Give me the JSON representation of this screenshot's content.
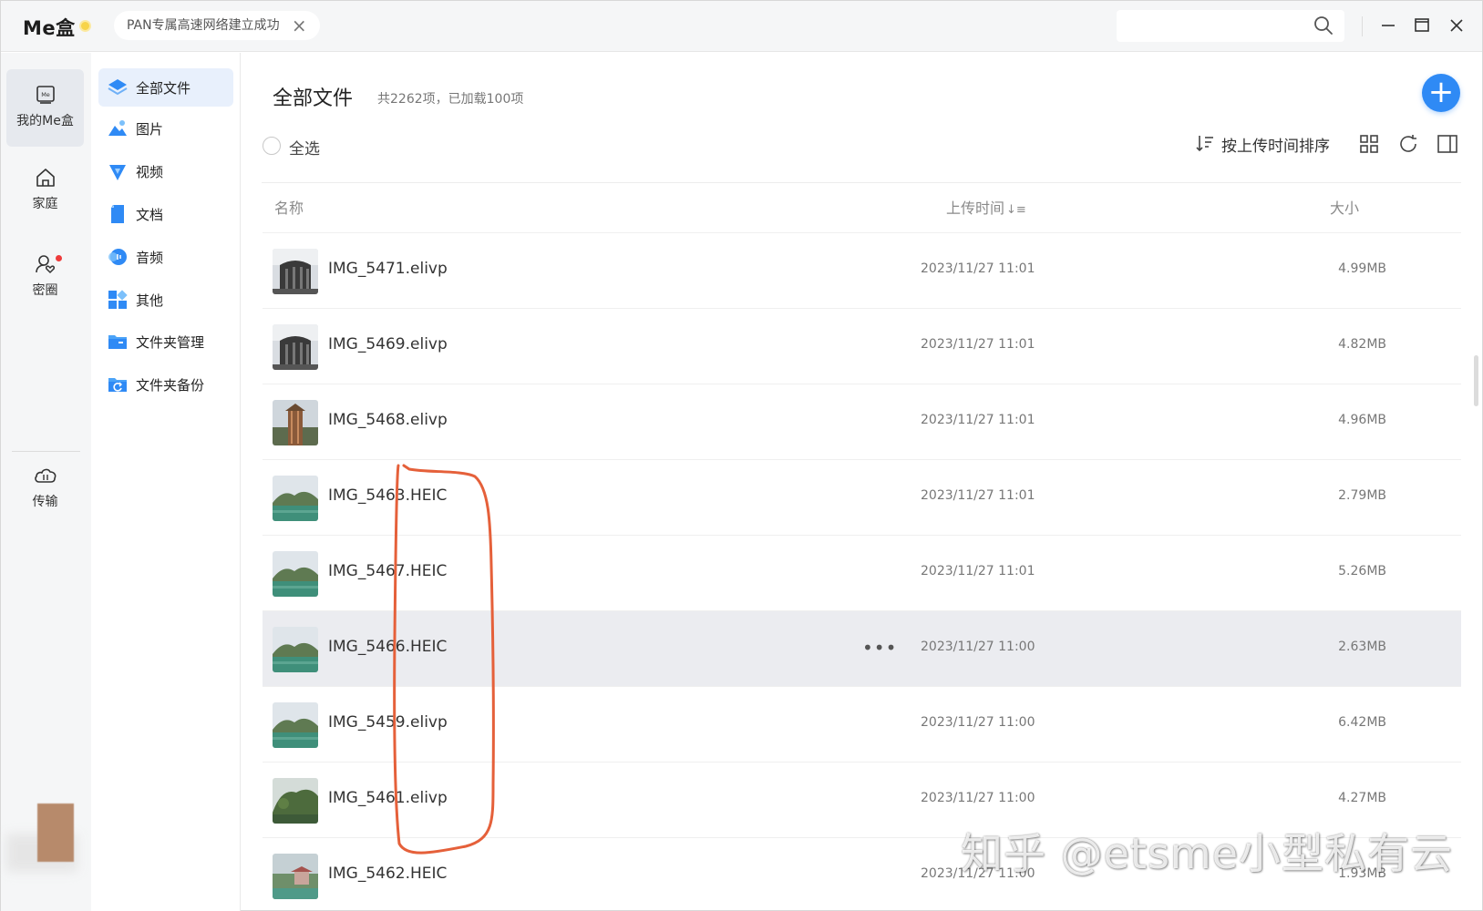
{
  "app": {
    "title": "Me盒",
    "notice": "PAN专属高速网络建立成功"
  },
  "rail": {
    "items": [
      {
        "label": "我的Me盒",
        "icon": "me-box-icon",
        "active": true
      },
      {
        "label": "家庭",
        "icon": "home-icon",
        "active": false
      },
      {
        "label": "密圈",
        "icon": "circle-friends-icon",
        "active": false,
        "badge": true
      },
      {
        "label": "传输",
        "icon": "cloud-transfer-icon",
        "active": false
      }
    ]
  },
  "categories": [
    {
      "label": "全部文件",
      "icon": "all-files-icon",
      "active": true
    },
    {
      "label": "图片",
      "icon": "pictures-icon",
      "active": false
    },
    {
      "label": "视频",
      "icon": "video-icon",
      "active": false
    },
    {
      "label": "文档",
      "icon": "document-icon",
      "active": false
    },
    {
      "label": "音频",
      "icon": "audio-icon",
      "active": false
    },
    {
      "label": "其他",
      "icon": "other-icon",
      "active": false
    },
    {
      "label": "文件夹管理",
      "icon": "folder-manage-icon",
      "active": false
    },
    {
      "label": "文件夹备份",
      "icon": "folder-backup-icon",
      "active": false
    }
  ],
  "main": {
    "title": "全部文件",
    "count_text": "共2262项，已加载100项",
    "select_all": "全选",
    "sort_label": "按上传时间排序",
    "columns": {
      "name": "名称",
      "time": "上传时间",
      "size": "大小"
    },
    "files": [
      {
        "name": "IMG_5471.elivp",
        "time": "2023/11/27 11:01",
        "size": "4.99MB",
        "thumb": "tower"
      },
      {
        "name": "IMG_5469.elivp",
        "time": "2023/11/27 11:01",
        "size": "4.82MB",
        "thumb": "tower"
      },
      {
        "name": "IMG_5468.elivp",
        "time": "2023/11/27 11:01",
        "size": "4.96MB",
        "thumb": "tower2"
      },
      {
        "name": "IMG_5463.HEIC",
        "time": "2023/11/27 11:01",
        "size": "2.79MB",
        "thumb": "lake"
      },
      {
        "name": "IMG_5467.HEIC",
        "time": "2023/11/27 11:01",
        "size": "5.26MB",
        "thumb": "lake"
      },
      {
        "name": "IMG_5466.HEIC",
        "time": "2023/11/27 11:00",
        "size": "2.63MB",
        "thumb": "lake",
        "hover": true
      },
      {
        "name": "IMG_5459.elivp",
        "time": "2023/11/27 11:00",
        "size": "6.42MB",
        "thumb": "lake"
      },
      {
        "name": "IMG_5461.elivp",
        "time": "2023/11/27 11:00",
        "size": "4.27MB",
        "thumb": "forest"
      },
      {
        "name": "IMG_5462.HEIC",
        "time": "2023/11/27 11:00",
        "size": "1.93MB",
        "thumb": "pavilion"
      }
    ]
  },
  "watermark": "知乎 @etsme小型私有云",
  "colors": {
    "accent": "#2f8af5",
    "annotation": "#e5603a",
    "hover_row": "#ebecf0"
  }
}
